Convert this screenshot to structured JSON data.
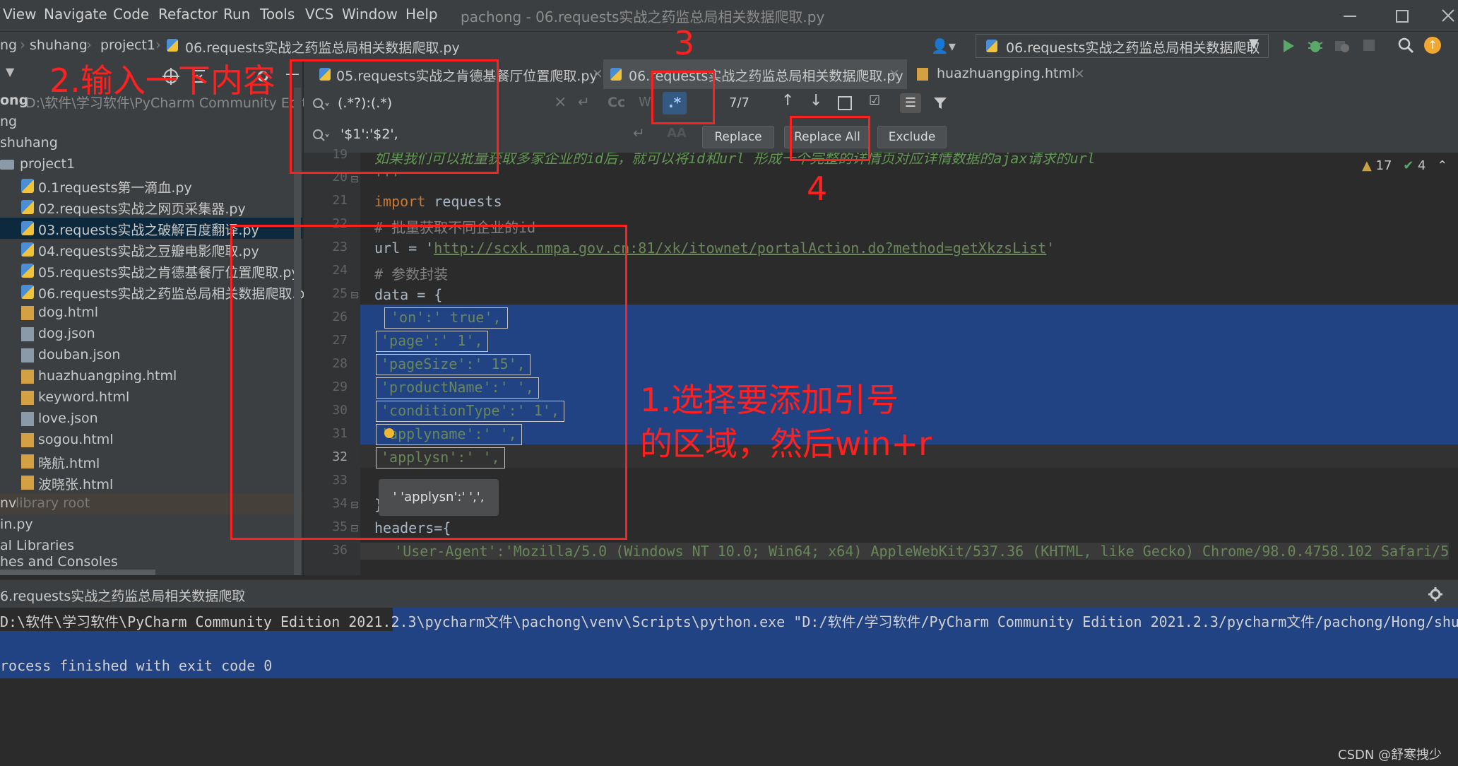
{
  "menubar": {
    "items": [
      "View",
      "Navigate",
      "Code",
      "Refactor",
      "Run",
      "Tools",
      "VCS",
      "Window",
      "Help"
    ],
    "window_title": "pachong - 06.requests实战之药监总局相关数据爬取.py"
  },
  "navbar": {
    "crumbs": [
      "ng",
      "shuhang",
      "project1",
      "06.requests实战之药监总局相关数据爬取.py"
    ],
    "run_config": "06.requests实战之药监总局相关数据爬取"
  },
  "project": {
    "root": "ong",
    "root_path": "D:\\软件\\学习软件\\PyCharm Community Edition",
    "rows": [
      {
        "label": "ng",
        "icon": "none"
      },
      {
        "label": "shuhang",
        "icon": "none"
      },
      {
        "label": "project1",
        "icon": "folder"
      },
      {
        "label": "0.1requests第一滴血.py",
        "icon": "python"
      },
      {
        "label": "02.requests实战之网页采集器.py",
        "icon": "python"
      },
      {
        "label": "03.requests实战之破解百度翻译.py",
        "icon": "python"
      },
      {
        "label": "04.requests实战之豆瓣电影爬取.py",
        "icon": "python"
      },
      {
        "label": "05.requests实战之肯德基餐厅位置爬取.py",
        "icon": "python"
      },
      {
        "label": "06.requests实战之药监总局相关数据爬取.py",
        "icon": "python"
      },
      {
        "label": "dog.html",
        "icon": "html"
      },
      {
        "label": "dog.json",
        "icon": "json"
      },
      {
        "label": "douban.json",
        "icon": "json"
      },
      {
        "label": "huazhuangping.html",
        "icon": "html"
      },
      {
        "label": "keyword.html",
        "icon": "html"
      },
      {
        "label": "love.json",
        "icon": "json"
      },
      {
        "label": "sogou.html",
        "icon": "html"
      },
      {
        "label": "晓航.html",
        "icon": "html"
      },
      {
        "label": "波晓张.html",
        "icon": "html"
      }
    ],
    "venv_label": "nv",
    "venv_note": "library root",
    "extra_rows": [
      "in.py",
      "al Libraries",
      "hes and Consoles"
    ]
  },
  "tabs": [
    {
      "label": "05.requests实战之肯德基餐厅位置爬取.py",
      "active": false
    },
    {
      "label": "06.requests实战之药监总局相关数据爬取.py",
      "active": true
    },
    {
      "label": "huazhuangping.html",
      "active": false
    }
  ],
  "find": {
    "search_value": "(.*?):(.*)",
    "replace_value": "'$1':'$2',",
    "match_case_label": "Cc",
    "regex_label": ".*",
    "match_count": "7/7",
    "replace_label": "Replace",
    "replace_all_label": "Replace All",
    "exclude_label": "Exclude"
  },
  "inspections": {
    "warnings": "17",
    "ok": "4"
  },
  "editor": {
    "line_19": "如果我们可以批量获取多家企业的id后，就可以将id和url 形成一个完整的详情页对应详情数据的ajax请求的url",
    "line_20": "'''",
    "line_21_kw": "import",
    "line_21_rest": " requests",
    "line_22": "# 批量获取不同企业的id",
    "line_23_pre": "url = '",
    "line_23_url": "http://scxk.nmpa.gov.cn:81/xk/itownet/portalAction.do?method=getXkzsList",
    "line_23_post": "'",
    "line_24": "# 参数封装",
    "line_25": "data = {",
    "matches": [
      "'on':' true',",
      "'page':' 1',",
      "'pageSize':' 15',",
      "'productName':' ',",
      "'conditionType':' 1',",
      "'applyname':' ',",
      "'applysn':' ',"
    ],
    "line_34": "}",
    "line_35": "headers={",
    "line_36": "    'User-Agent':'Mozilla/5.0 (Windows NT 10.0; Win64; x64) AppleWebKit/537.36 (KHTML, like Gecko) Chrome/98.0.4758.102 Safari/5",
    "tooltip": "' 'applysn':' ',',",
    "line_numbers": [
      "19",
      "20",
      "21",
      "22",
      "23",
      "24",
      "25",
      "26",
      "27",
      "28",
      "29",
      "30",
      "31",
      "32",
      "33",
      "34",
      "35",
      "36"
    ]
  },
  "run": {
    "tab_label": "6.requests实战之药监总局相关数据爬取",
    "line1": "D:\\软件\\学习软件\\PyCharm Community Edition 2021.2.3\\pycharm文件\\pachong\\venv\\Scripts\\python.exe \"D:/软件/学习软件/PyCharm Community Edition 2021.2.3/pycharm文件/pachong/Hong/shuh",
    "line2": "rocess finished with exit code 0"
  },
  "annotations": {
    "step1_line1": "1.选择要添加引号",
    "step1_line2": "的区域，然后win+r",
    "step2": "2.输入一下内容",
    "step3": "3",
    "step4": "4"
  },
  "watermark": "CSDN @舒寒拽少",
  "colors": {
    "annotation": "#ff2020",
    "selection": "#214283",
    "background": "#2b2b2b",
    "panel": "#3c3f41"
  }
}
